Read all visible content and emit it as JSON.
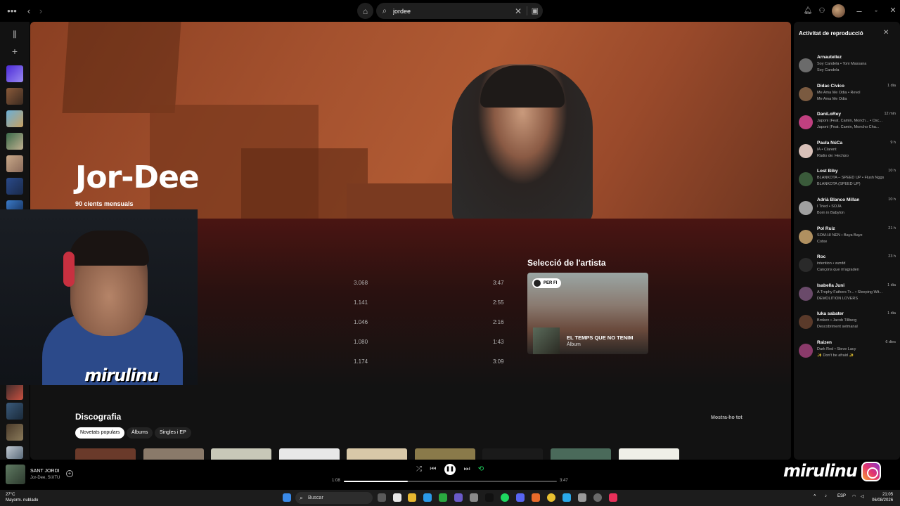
{
  "topbar": {
    "search_value": "jordee",
    "menu_icon": "more-horizontal-icon"
  },
  "artist": {
    "name": "Jor-Dee",
    "listeners": "90 cients mensuals"
  },
  "popular_tracks": [
    {
      "plays": "3.068",
      "duration": "3:47"
    },
    {
      "plays": "1.141",
      "duration": "2:55"
    },
    {
      "plays": "1.046",
      "duration": "2:16"
    },
    {
      "plays": "1.080",
      "duration": "1:43"
    },
    {
      "plays": "1.174",
      "duration": "3:09"
    }
  ],
  "artist_pick": {
    "title": "Selecció de l'artista",
    "tag": "PER FI",
    "album_name": "EL TEMPS QUE NO TENIM",
    "album_type": "Àlbum"
  },
  "discography": {
    "title": "Discografia",
    "show_all": "Mostra-ho tot",
    "chips": [
      "Novetats populars",
      "Àlbums",
      "Singles i EP"
    ]
  },
  "webcam": {
    "overlay_text": "mirulinu"
  },
  "friend_activity": {
    "title": "Activitat de reproducció",
    "friends": [
      {
        "name": "Arnautellez",
        "time": "",
        "track": "Soy Candela • Toni Massana",
        "context": "Soy Candela",
        "avatar_color": "#6b6b6b"
      },
      {
        "name": "Didac Civico",
        "time": "1 dia",
        "track": "Me Ama Me Odia • Revol",
        "context": "Me Ama Me Odia",
        "avatar_color": "#7a5a40"
      },
      {
        "name": "DaniLoRey",
        "time": "12 min",
        "track": "Japoni (Feat. Camin, Monch... • Osc...",
        "context": "Japoni (Feat. Camin, Moncho Cha...",
        "avatar_color": "#c04080"
      },
      {
        "name": "Paula NúCa",
        "time": "9 h",
        "track": "IA • Clarent",
        "context": "Ràdio de: Hechizo",
        "avatar_color": "#d8c0b8"
      },
      {
        "name": "Lost Biby",
        "time": "10 h",
        "track": "BLANKOTA – SPEED UP • Flush Nggs",
        "context": "BLANKOTA (SPEED UP)",
        "avatar_color": "#3a5a3a"
      },
      {
        "name": "Adrià Blanco Millan",
        "time": "10 h",
        "track": "I Tried • SOJA",
        "context": "Born in Babylon",
        "avatar_color": "#a0a0a0"
      },
      {
        "name": "Pol Ruiz",
        "time": "21 h",
        "track": "SOM-HI NEN • Baya Baye",
        "context": "Cotxe",
        "avatar_color": "#b09060"
      },
      {
        "name": "Roc",
        "time": "23 h",
        "track": "intention • wzrdd",
        "context": "Cançons que m'agraden",
        "avatar_color": "#2a2a2a"
      },
      {
        "name": "Isabella Juni",
        "time": "1 dia",
        "track": "A Trophy Fathers Tr... • Sleeping Wit...",
        "context": "DEMOLITION LOVERS",
        "avatar_color": "#6a4a6a"
      },
      {
        "name": "luka sabater",
        "time": "1 dia",
        "track": "Broken • Jacob Tillberg",
        "context": "Descobriment setmanal",
        "avatar_color": "#5a3a2a"
      },
      {
        "name": "Raizen",
        "time": "6 dies",
        "track": "Dark Red • Steve Lacy",
        "context": "✨ Don't be afraid ✨",
        "avatar_color": "#8a3a6a"
      }
    ]
  },
  "player": {
    "title": "SANT JORDI",
    "artist": "Jor-Dee, SIXTU",
    "elapsed": "1:08",
    "total": "3:47",
    "progress_fraction": 0.3
  },
  "stream_brand": "mirulinu",
  "taskbar": {
    "weather_temp": "27°C",
    "weather_desc": "Mayorm. nublado",
    "search_placeholder": "Buscar",
    "lang": "ESP",
    "time": "21:05",
    "date": "06/08/2026"
  }
}
